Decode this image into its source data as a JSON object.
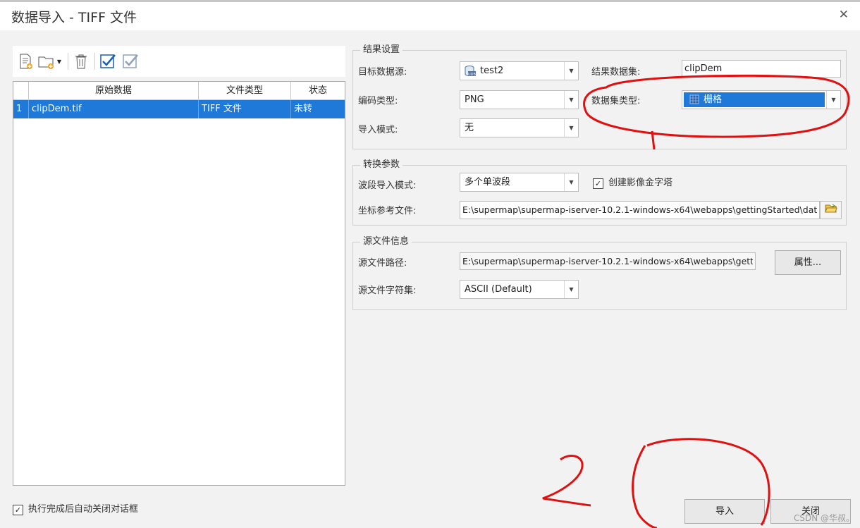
{
  "window": {
    "title": "数据导入 - TIFF 文件"
  },
  "toolbar": {
    "icons": [
      "add-file-icon",
      "add-folder-icon",
      "delete-icon",
      "select-all-icon",
      "invert-select-icon"
    ]
  },
  "grid": {
    "columns": [
      "原始数据",
      "文件类型",
      "状态"
    ],
    "rows": [
      {
        "index": "1",
        "name": "clipDem.tif",
        "type": "TIFF 文件",
        "status": "未转"
      }
    ]
  },
  "result_settings": {
    "title": "结果设置",
    "target_datasource_label": "目标数据源:",
    "target_datasource_value": "test2",
    "result_dataset_label": "结果数据集:",
    "result_dataset_value": "clipDem",
    "encoding_label": "编码类型:",
    "encoding_value": "PNG",
    "dataset_type_label": "数据集类型:",
    "dataset_type_value": "栅格",
    "import_mode_label": "导入模式:",
    "import_mode_value": "无"
  },
  "conversion": {
    "title": "转换参数",
    "band_mode_label": "波段导入模式:",
    "band_mode_value": "多个单波段",
    "pyramid_label": "创建影像金字塔",
    "pyramid_checked": true,
    "coord_file_label": "坐标参考文件:",
    "coord_file_value": "E:\\supermap\\supermap-iserver-10.2.1-windows-x64\\webapps\\gettingStarted\\data\\de"
  },
  "source_info": {
    "title": "源文件信息",
    "path_label": "源文件路径:",
    "path_value": "E:\\supermap\\supermap-iserver-10.2.1-windows-x64\\webapps\\getting:",
    "properties_button": "属性...",
    "charset_label": "源文件字符集:",
    "charset_value": "ASCII (Default)"
  },
  "footer": {
    "auto_close_label": "执行完成后自动关闭对话框",
    "auto_close_checked": true,
    "import_button": "导入",
    "close_button": "关闭",
    "watermark": "CSDN @华叔。"
  },
  "colors": {
    "selection": "#1f79d8",
    "annotation": "#e01010",
    "accent_check": "#1a5fb4"
  }
}
